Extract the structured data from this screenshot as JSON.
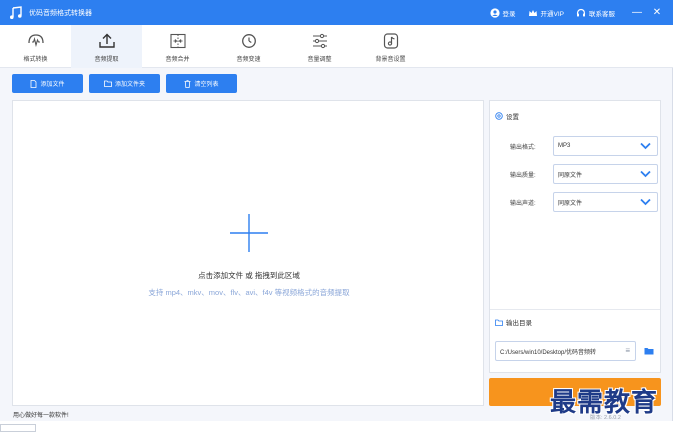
{
  "window": {
    "title": "优码音频格式转换器",
    "login_label": "登录",
    "vip_label": "开通VIP",
    "contact_label": "联系客服",
    "minimize_glyph": "—",
    "close_glyph": "✕"
  },
  "tabs": [
    {
      "label": "格式转换",
      "icon": "waveform-icon"
    },
    {
      "label": "音频提取",
      "icon": "upload-icon",
      "active": true
    },
    {
      "label": "音频合并",
      "icon": "merge-icon"
    },
    {
      "label": "音频变速",
      "icon": "speed-icon"
    },
    {
      "label": "音量调整",
      "icon": "sliders-icon"
    },
    {
      "label": "背景音设置",
      "icon": "music-note-icon"
    }
  ],
  "actions": {
    "add_file": "添加文件",
    "add_folder": "添加文件夹",
    "clear_list": "清空列表"
  },
  "dropzone": {
    "main_text": "点击添加文件 或 拖拽到此区域",
    "sub_text": "支持 mp4、mkv、mov、flv、avi、f4v 等视频格式的音频提取"
  },
  "settings": {
    "title": "设置",
    "format_label": "输出格式:",
    "format_value": "MP3",
    "quality_label": "输出质量:",
    "quality_value": "同原文件",
    "channel_label": "输出声道:",
    "channel_value": "同原文件",
    "output_dir_title": "输出目录",
    "output_dir_value": "C:/Users/win10/Desktop/优码音频转",
    "menu_glyph": "≡"
  },
  "version": "版本: 2.6.0.2",
  "statusbar": "用心做好每一款软件!",
  "watermark": "最需教育",
  "colors": {
    "accent": "#2d7ff0",
    "start": "#f7941d"
  }
}
